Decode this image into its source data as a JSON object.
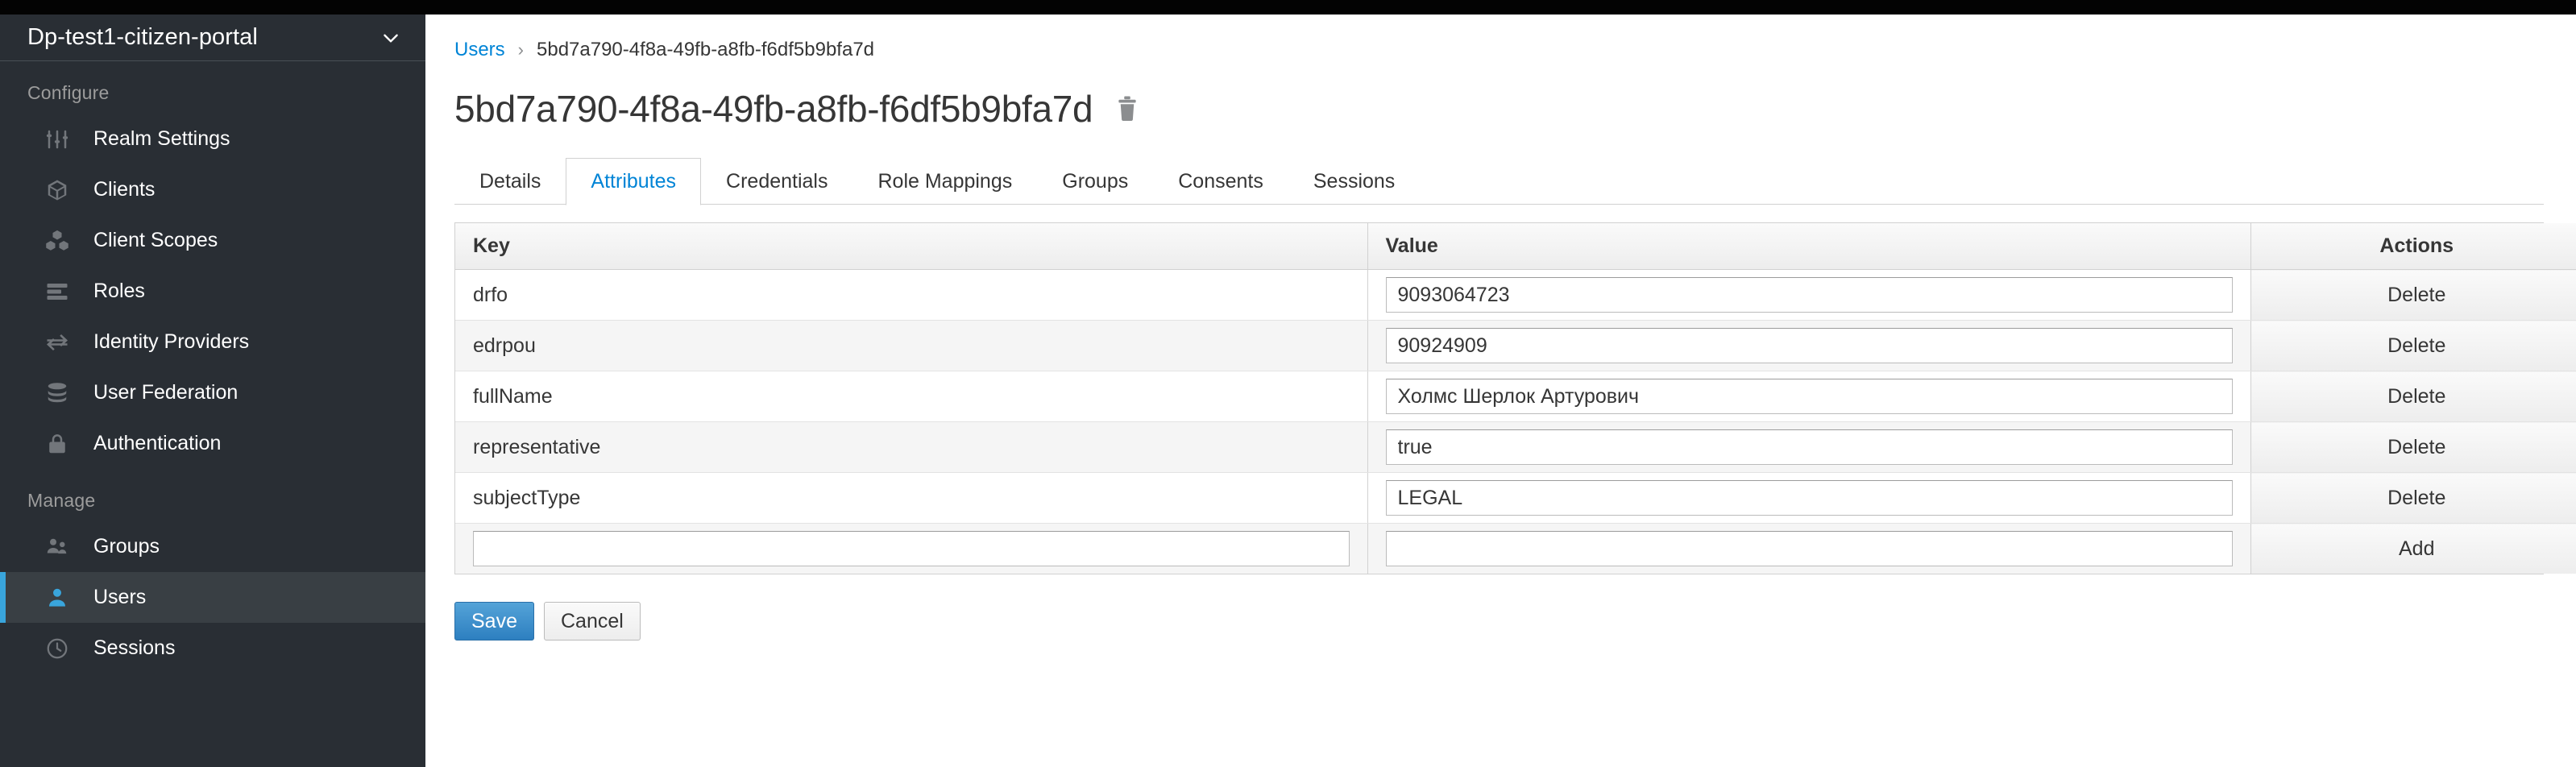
{
  "topbar": {
    "present": true
  },
  "sidebar": {
    "realm": {
      "name": "Dp-test1-citizen-portal",
      "caret_icon": "chevron-down-icon"
    },
    "sections": [
      {
        "title": "Configure",
        "items": [
          {
            "label": "Realm Settings",
            "icon": "sliders-icon",
            "active": false
          },
          {
            "label": "Clients",
            "icon": "cube-icon",
            "active": false
          },
          {
            "label": "Client Scopes",
            "icon": "cubes-icon",
            "active": false
          },
          {
            "label": "Roles",
            "icon": "list-icon",
            "active": false
          },
          {
            "label": "Identity Providers",
            "icon": "exchange-icon",
            "active": false
          },
          {
            "label": "User Federation",
            "icon": "database-icon",
            "active": false
          },
          {
            "label": "Authentication",
            "icon": "lock-icon",
            "active": false
          }
        ]
      },
      {
        "title": "Manage",
        "items": [
          {
            "label": "Groups",
            "icon": "users-icon",
            "active": false
          },
          {
            "label": "Users",
            "icon": "user-icon",
            "active": true
          },
          {
            "label": "Sessions",
            "icon": "clock-icon",
            "active": false
          }
        ]
      }
    ]
  },
  "breadcrumb": {
    "parent": "Users",
    "separator": "›",
    "current": "5bd7a790-4f8a-49fb-a8fb-f6df5b9bfa7d"
  },
  "header": {
    "title": "5bd7a790-4f8a-49fb-a8fb-f6df5b9bfa7d",
    "delete_icon": "trash-icon"
  },
  "tabs": [
    {
      "label": "Details",
      "active": false
    },
    {
      "label": "Attributes",
      "active": true
    },
    {
      "label": "Credentials",
      "active": false
    },
    {
      "label": "Role Mappings",
      "active": false
    },
    {
      "label": "Groups",
      "active": false
    },
    {
      "label": "Consents",
      "active": false
    },
    {
      "label": "Sessions",
      "active": false
    }
  ],
  "table": {
    "columns": {
      "key": "Key",
      "value": "Value",
      "actions": "Actions"
    },
    "rows": [
      {
        "key": "drfo",
        "value": "9093064723",
        "action": "Delete",
        "editable_key": false
      },
      {
        "key": "edrpou",
        "value": "90924909",
        "action": "Delete",
        "editable_key": false
      },
      {
        "key": "fullName",
        "value": "Холмс Шерлок Артурович",
        "action": "Delete",
        "editable_key": false
      },
      {
        "key": "representative",
        "value": "true",
        "action": "Delete",
        "editable_key": false
      },
      {
        "key": "subjectType",
        "value": "LEGAL",
        "action": "Delete",
        "editable_key": false
      },
      {
        "key": "",
        "value": "",
        "action": "Add",
        "editable_key": true
      }
    ]
  },
  "form_actions": {
    "save": "Save",
    "cancel": "Cancel"
  },
  "colors": {
    "sidebar_bg": "#292e34",
    "sidebar_active_bg": "#393f44",
    "accent": "#0084d6",
    "active_marker": "#39a5dc",
    "primary_button": "#2d7fc0"
  }
}
